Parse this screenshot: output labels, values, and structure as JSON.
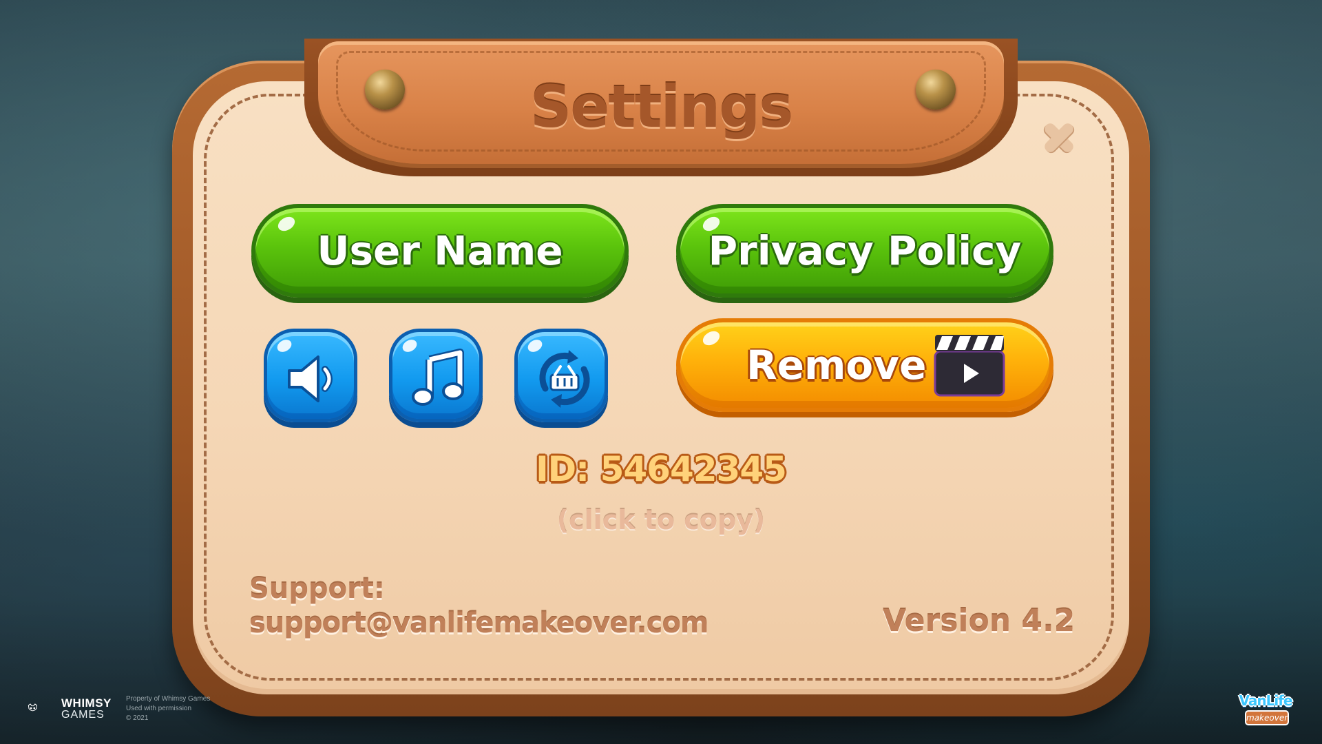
{
  "dialog": {
    "title": "Settings"
  },
  "buttons": {
    "user_name": "User Name",
    "privacy_policy": "Privacy Policy",
    "remove_ads": "Remove"
  },
  "icon_buttons": [
    {
      "name": "sound-toggle",
      "icon": "speaker-icon"
    },
    {
      "name": "music-toggle",
      "icon": "music-note-icon"
    },
    {
      "name": "restore-purchases",
      "icon": "basket-refresh-icon"
    }
  ],
  "player": {
    "id_text": "ID: 54642345",
    "copy_hint": "(click to copy)"
  },
  "support": {
    "label": "Support:",
    "email": "support@vanlifemakeover.com"
  },
  "version": "Version 4.2",
  "footer": {
    "studio_name": "WHIMSY",
    "studio_sub": "GAMES",
    "legal_lines": [
      "Property of Whimsy Games",
      "Used with permission",
      "© 2021"
    ],
    "game_logo_top": "VanLife",
    "game_logo_bottom": "makeover"
  },
  "colors": {
    "green_button": "#5bc40c",
    "orange_button": "#ffb10a",
    "blue_button": "#129aef",
    "panel_leather": "#9a5424",
    "panel_parchment": "#f5d7b6",
    "title_text": "#a5572a"
  }
}
